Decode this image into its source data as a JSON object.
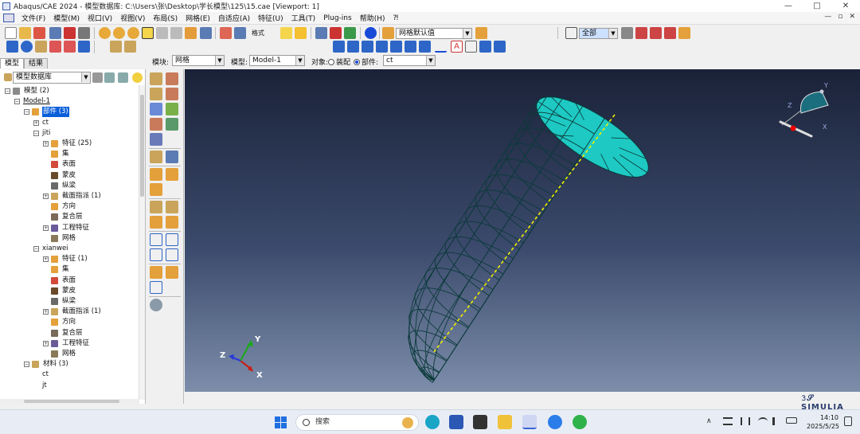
{
  "window": {
    "title": "Abaqus/CAE 2024 - 模型数据库: C:\\Users\\张\\Desktop\\学长模型\\125\\15.cae [Viewport: 1]",
    "min_glyph": "—",
    "max_glyph": "□",
    "close_glyph": "✕"
  },
  "menu": {
    "items": [
      "文件(F)",
      "模型(M)",
      "视口(V)",
      "视图(V)",
      "布局(S)",
      "网格(E)",
      "自适应(A)",
      "特征(U)",
      "工具(T)",
      "Plug-ins",
      "帮助(H)",
      "⁈"
    ],
    "mdi_min": "—",
    "mdi_restore": "▫",
    "mdi_close": "✕"
  },
  "toolbar1": {
    "text_label": "格式",
    "render_style_combo": "网格默认值",
    "selection_combo": "全部"
  },
  "context": {
    "module_label": "模块:",
    "module_value": "网格",
    "model_label": "模型:",
    "model_value": "Model-1",
    "object_label": "对象:",
    "assembly_option": "装配",
    "part_option": "部件:",
    "part_value": "ct"
  },
  "tabs": [
    "模型",
    "结果"
  ],
  "tree": {
    "combo": "模型数据库",
    "rows": [
      {
        "label": "模型 (2)",
        "level": 0,
        "exp": "-",
        "icon": "models"
      },
      {
        "label": "Model-1",
        "level": 1,
        "exp": "-",
        "icon": "",
        "underline": true
      },
      {
        "label": "部件 (3)",
        "level": 2,
        "exp": "-",
        "icon": "parts",
        "selected": true
      },
      {
        "label": "ct",
        "level": 3,
        "exp": "+",
        "icon": ""
      },
      {
        "label": "jiti",
        "level": 3,
        "exp": "-",
        "icon": ""
      },
      {
        "label": "特征 (25)",
        "level": 4,
        "exp": "+",
        "icon": "feature"
      },
      {
        "label": "集",
        "level": 4,
        "exp": "",
        "icon": "set"
      },
      {
        "label": "表面",
        "level": 4,
        "exp": "",
        "icon": "surface"
      },
      {
        "label": "蒙皮",
        "level": 4,
        "exp": "",
        "icon": "skin"
      },
      {
        "label": "纵梁",
        "level": 4,
        "exp": "",
        "icon": "stringer"
      },
      {
        "label": "截面指派 (1)",
        "level": 4,
        "exp": "+",
        "icon": "section"
      },
      {
        "label": "方向",
        "level": 4,
        "exp": "",
        "icon": "orient"
      },
      {
        "label": "复合层",
        "level": 4,
        "exp": "",
        "icon": "composite"
      },
      {
        "label": "工程特征",
        "level": 4,
        "exp": "+",
        "icon": "engfeat"
      },
      {
        "label": "网格",
        "level": 4,
        "exp": "",
        "icon": "mesh"
      },
      {
        "label": "xianwei",
        "level": 3,
        "exp": "-",
        "icon": ""
      },
      {
        "label": "特征 (1)",
        "level": 4,
        "exp": "+",
        "icon": "feature"
      },
      {
        "label": "集",
        "level": 4,
        "exp": "",
        "icon": "set"
      },
      {
        "label": "表面",
        "level": 4,
        "exp": "",
        "icon": "surface"
      },
      {
        "label": "蒙皮",
        "level": 4,
        "exp": "",
        "icon": "skin"
      },
      {
        "label": "纵梁",
        "level": 4,
        "exp": "",
        "icon": "stringer"
      },
      {
        "label": "截面指派 (1)",
        "level": 4,
        "exp": "+",
        "icon": "section"
      },
      {
        "label": "方向",
        "level": 4,
        "exp": "",
        "icon": "orient"
      },
      {
        "label": "复合层",
        "level": 4,
        "exp": "",
        "icon": "composite"
      },
      {
        "label": "工程特征",
        "level": 4,
        "exp": "+",
        "icon": "engfeat"
      },
      {
        "label": "网格",
        "level": 4,
        "exp": "",
        "icon": "mesh"
      },
      {
        "label": "材料 (3)",
        "level": 2,
        "exp": "-",
        "icon": "material"
      },
      {
        "label": "ct",
        "level": 3,
        "exp": "",
        "icon": ""
      },
      {
        "label": "jt",
        "level": 3,
        "exp": "",
        "icon": ""
      }
    ]
  },
  "viewport": {
    "triad_x": "X",
    "triad_y": "Y",
    "triad_z": "Z",
    "compass_x": "X",
    "compass_y": "Y",
    "compass_z": "Z",
    "mesh_color": "#22e8e0",
    "background_top": "#1a2238",
    "background_bottom": "#7d8eab"
  },
  "brand": {
    "simulia": "SIMULIA"
  },
  "taskbar": {
    "search_placeholder": "搜索",
    "time": "14:10",
    "date": "2025/5/25",
    "tray_chevron": "∧"
  }
}
